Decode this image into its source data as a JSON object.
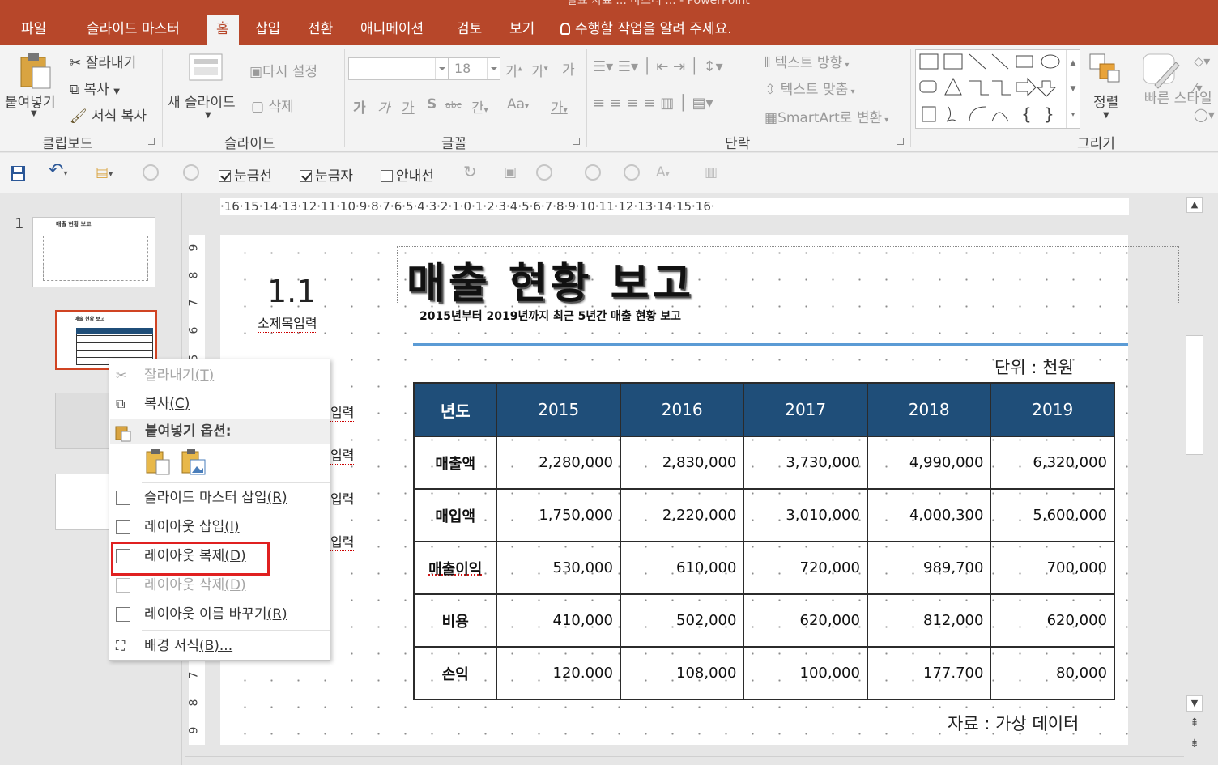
{
  "window": {
    "title_partial": "발표 자료 ... 마스터 ... - PowerPoint"
  },
  "tabs": [
    {
      "label": "파일"
    },
    {
      "label": "슬라이드 마스터"
    },
    {
      "label": "홈"
    },
    {
      "label": "삽입"
    },
    {
      "label": "전환"
    },
    {
      "label": "애니메이션"
    },
    {
      "label": "검토"
    },
    {
      "label": "보기"
    }
  ],
  "tell_me": "수행할 작업을 알려 주세요.",
  "ribbon": {
    "clipboard": {
      "paste": "붙여넣기",
      "cut": "잘라내기",
      "copy": "복사",
      "format_painter": "서식 복사",
      "group": "클립보드"
    },
    "slides": {
      "new_slide": "새 슬라이드",
      "reset": "다시 설정",
      "delete": "삭제",
      "group": "슬라이드"
    },
    "font": {
      "size": "18",
      "group": "글꼴",
      "bold": "가",
      "italic": "가",
      "underline": "가",
      "shadow": "S",
      "strike": "abc",
      "spacing": "간",
      "case": "Aa",
      "clear": "가"
    },
    "paragraph": {
      "text_direction": "텍스트 방향",
      "align_text": "텍스트 맞춤",
      "smartart": "SmartArt로 변환",
      "group": "단락"
    },
    "drawing": {
      "arrange": "정렬",
      "quick_styles": "빠른 스타일",
      "group": "그리기"
    }
  },
  "qat": {
    "gridlines": "눈금선",
    "ruler": "눈금자",
    "guides": "안내선"
  },
  "thumbnails": {
    "first_number": "1",
    "title": "매출 현황 보고"
  },
  "ruler_h": "·16·15·14·13·12·11·10·9·8·7·6·5·4·3·2·1·0·1·2·3·4·5·6·7·8·9·10·11·12·13·14·15·16·",
  "slide": {
    "number": "1.1",
    "subhead": "소제목입력",
    "title": "매출 현황 보고",
    "subtitle": "2015년부터 2019년까지 최근 5년간 매출 현황 보고",
    "unit": "단위 : 천원",
    "source": "자료 : 가상 데이터",
    "input_label": "입력",
    "table": {
      "headers": [
        "년도",
        "2015",
        "2016",
        "2017",
        "2018",
        "2019"
      ],
      "rows": [
        {
          "label": "매출액",
          "values": [
            "2,280,000",
            "2,830,000",
            "3,730,000",
            "4,990,000",
            "6,320,000"
          ]
        },
        {
          "label": "매입액",
          "values": [
            "1,750,000",
            "2,220,000",
            "3,010,000",
            "4,000,300",
            "5,600,000"
          ]
        },
        {
          "label": "매출이익",
          "values": [
            "530,000",
            "610,000",
            "720,000",
            "989,700",
            "700,000"
          ]
        },
        {
          "label": "비용",
          "values": [
            "410,000",
            "502,000",
            "620,000",
            "812,000",
            "620,000"
          ]
        },
        {
          "label": "손익",
          "values": [
            "120.000",
            "108,000",
            "100,000",
            "177.700",
            "80,000"
          ]
        }
      ]
    }
  },
  "context_menu": {
    "cut": "잘라내기",
    "cut_key": "(T)",
    "copy": "복사",
    "copy_key": "(C)",
    "paste_options": "붙여넣기 옵션:",
    "insert_master": "슬라이드 마스터 삽입",
    "insert_master_key": "(R)",
    "insert_layout": "레이아웃 삽입",
    "insert_layout_key": "(I)",
    "duplicate_layout": "레이아웃 복제",
    "duplicate_layout_key": "(D)",
    "delete_layout": "레이아웃 삭제",
    "delete_layout_key": "(D)",
    "rename_layout": "레이아웃 이름 바꾸기",
    "rename_layout_key": "(R)",
    "format_background": "배경 서식",
    "format_background_key": "(B)..."
  },
  "colors": {
    "accent": "#b7472a",
    "table_header": "#1f4e79",
    "rule_line": "#5b9bd5",
    "highlight": "#e02020"
  }
}
